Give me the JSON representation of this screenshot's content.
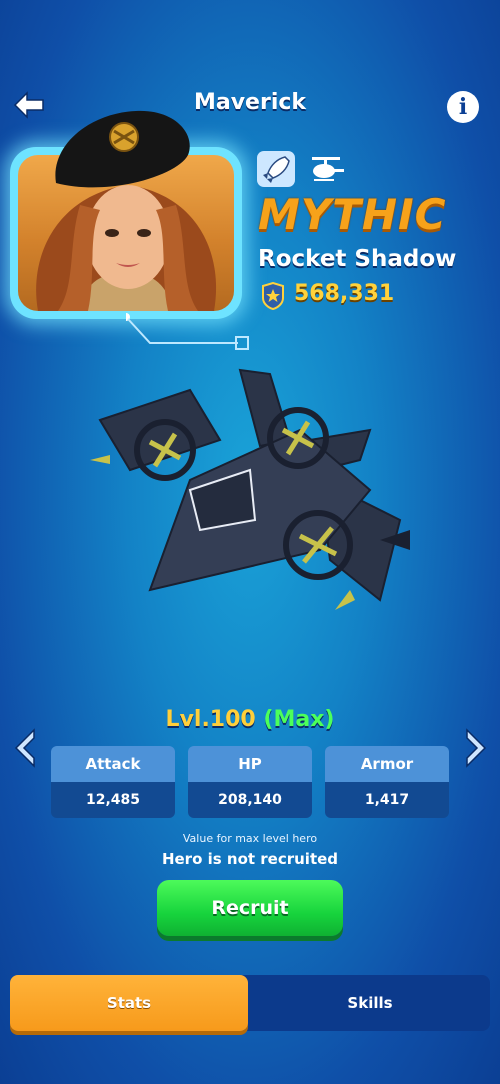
{
  "header": {
    "title": "Maverick"
  },
  "hero": {
    "rarity": "MYTHIC",
    "type": "Rocket Shadow",
    "power": "568,331",
    "class_icons": [
      "rocket-icon",
      "helicopter-icon"
    ]
  },
  "level": {
    "label": "Lvl.100",
    "max": "(Max)"
  },
  "stats": [
    {
      "label": "Attack",
      "value": "12,485"
    },
    {
      "label": "HP",
      "value": "208,140"
    },
    {
      "label": "Armor",
      "value": "1,417"
    }
  ],
  "note": "Value for max level hero",
  "status": "Hero is not recruited",
  "recruit_label": "Recruit",
  "tabs": {
    "stats": "Stats",
    "skills": "Skills"
  },
  "colors": {
    "rarity": "#f6a21a",
    "power": "#ffd23c",
    "max": "#4cff5a",
    "recruit": "#17d43d",
    "active_tab": "#f79a1b"
  }
}
